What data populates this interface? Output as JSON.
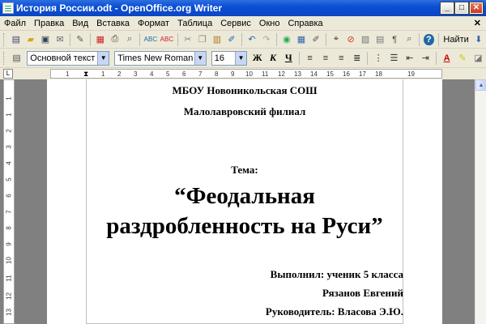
{
  "window": {
    "title": "История России.odt - OpenOffice.org Writer",
    "minimize": "_",
    "maximize": "□",
    "close": "✕"
  },
  "menu": {
    "items": [
      "Файл",
      "Правка",
      "Вид",
      "Вставка",
      "Формат",
      "Таблица",
      "Сервис",
      "Окно",
      "Справка"
    ],
    "close_doc": "✕"
  },
  "toolbar": {
    "find_label": "Найти",
    "zoom_icons": [
      "new-icon",
      "open-icon",
      "save-icon",
      "email-icon",
      "edit-icon",
      "pdf-icon",
      "print-icon",
      "preview-icon",
      "spellcheck-icon",
      "autospell-icon",
      "cut-icon",
      "copy-icon",
      "paste-icon",
      "clone-icon",
      "undo-icon",
      "redo-icon",
      "hyperlink-icon",
      "table-icon",
      "draw-icon",
      "navigator-icon",
      "gallery-icon",
      "datasources-icon",
      "nonprinting-icon",
      "zoom-icon",
      "help-icon"
    ]
  },
  "formatting": {
    "style": "Основной текст",
    "font": "Times New Roman",
    "size": "16",
    "bold": "Ж",
    "italic": "К",
    "underline": "Ч"
  },
  "ruler": {
    "numbers": [
      "1",
      "1",
      "2",
      "3",
      "4",
      "5",
      "6",
      "7",
      "8",
      "9",
      "10",
      "11",
      "12",
      "13",
      "14",
      "15",
      "16",
      "17",
      "18",
      "19"
    ],
    "vertical_numbers": [
      "1",
      "1",
      "2",
      "3",
      "4",
      "5",
      "6",
      "7",
      "8",
      "9",
      "10",
      "11",
      "12",
      "13"
    ]
  },
  "document": {
    "school": "МБОУ Новоникольская СОШ",
    "branch": "Малолавровский филиал",
    "topic_label": "Тема:",
    "title_line1": "“Феодальная",
    "title_line2": "раздробленность на Руси”",
    "author_label": "Выполнил: ученик 5 класса",
    "author_name": "Рязанов Евгений",
    "supervisor": "Руководитель: Власова Э.Ю."
  }
}
